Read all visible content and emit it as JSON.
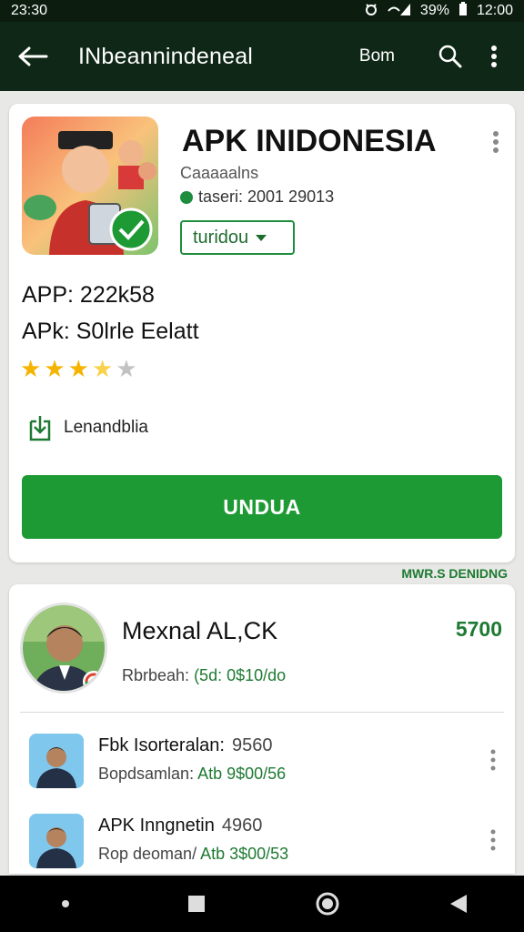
{
  "status_bar": {
    "time": "23:30",
    "battery": "39%",
    "clock_right": "12:00"
  },
  "app_bar": {
    "title": "INbeannindeneal",
    "action_text": "Bom"
  },
  "app_card": {
    "title": "APK INIDONESIA",
    "category": "Caaaaalns",
    "updated": "taseri: 2001 29013",
    "dropdown": "turidou",
    "line1": "APP: 222k58",
    "line2": "APk: S0lrle Eelatt",
    "rating": 3.5,
    "install_label": "Lenandblia",
    "button": "UNDUA"
  },
  "notice": "MWR.S DENIDNG",
  "featured": {
    "name": "Mexnal AL,CK",
    "count": "5700",
    "sub_prefix": "Rbrbeah: ",
    "sub_value": "(5d: 0$10/do"
  },
  "list": [
    {
      "title": "Fbk Isorteralan:",
      "num": "9560",
      "sub_prefix": "Bopdsamlan: ",
      "sub_value": "Atb 9$00/56"
    },
    {
      "title": "APK Inngnetin",
      "num": "4960",
      "sub_prefix": "Rop deoman/ ",
      "sub_value": "Atb 3$00/53"
    }
  ],
  "colors": {
    "appbar": "#0f2716",
    "accent": "#1d9a34",
    "accent_text": "#1e7a32"
  },
  "icons": [
    "back-arrow-icon",
    "search-icon",
    "more-vert-icon",
    "install-icon",
    "star-icon",
    "nav-home-icon",
    "nav-back-icon",
    "nav-recents-icon"
  ]
}
